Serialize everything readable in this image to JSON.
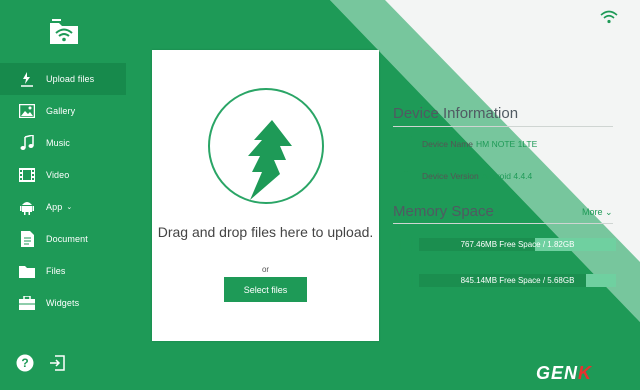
{
  "sidebar": {
    "items": [
      {
        "label": "Upload files",
        "icon": "upload-icon",
        "active": true
      },
      {
        "label": "Gallery",
        "icon": "gallery-icon"
      },
      {
        "label": "Music",
        "icon": "music-icon"
      },
      {
        "label": "Video",
        "icon": "video-icon"
      },
      {
        "label": "App",
        "icon": "app-icon",
        "caret": "⌄"
      },
      {
        "label": "Document",
        "icon": "document-icon"
      },
      {
        "label": "Files",
        "icon": "folder-icon"
      },
      {
        "label": "Widgets",
        "icon": "widgets-icon"
      }
    ],
    "bottom": [
      "help-icon",
      "logout-icon"
    ]
  },
  "upload": {
    "drop_text": "Drag and drop files here to upload.",
    "or_text": "or",
    "select_label": "Select files"
  },
  "device": {
    "title": "Device Information",
    "name_label": "Device Name",
    "name_value": "HM NOTE 1LTE",
    "version_label": "Device Version",
    "version_value": "Android 4.4.4"
  },
  "memory": {
    "title": "Memory Space",
    "more_label": "More ⌄",
    "rows": [
      {
        "text": "767.46MB Free Space / 1.82GB",
        "used_fraction": 0.59,
        "icon": "phone-storage-icon"
      },
      {
        "text": "845.14MB Free Space / 5.68GB",
        "used_fraction": 0.85,
        "icon": "sd-card-icon"
      }
    ]
  },
  "watermark": {
    "text": "GEN",
    "accent": "K"
  },
  "colors": {
    "brand": "#1e9a57",
    "brand_dark": "#178a4c",
    "bar_light": "#6fd0a0"
  }
}
